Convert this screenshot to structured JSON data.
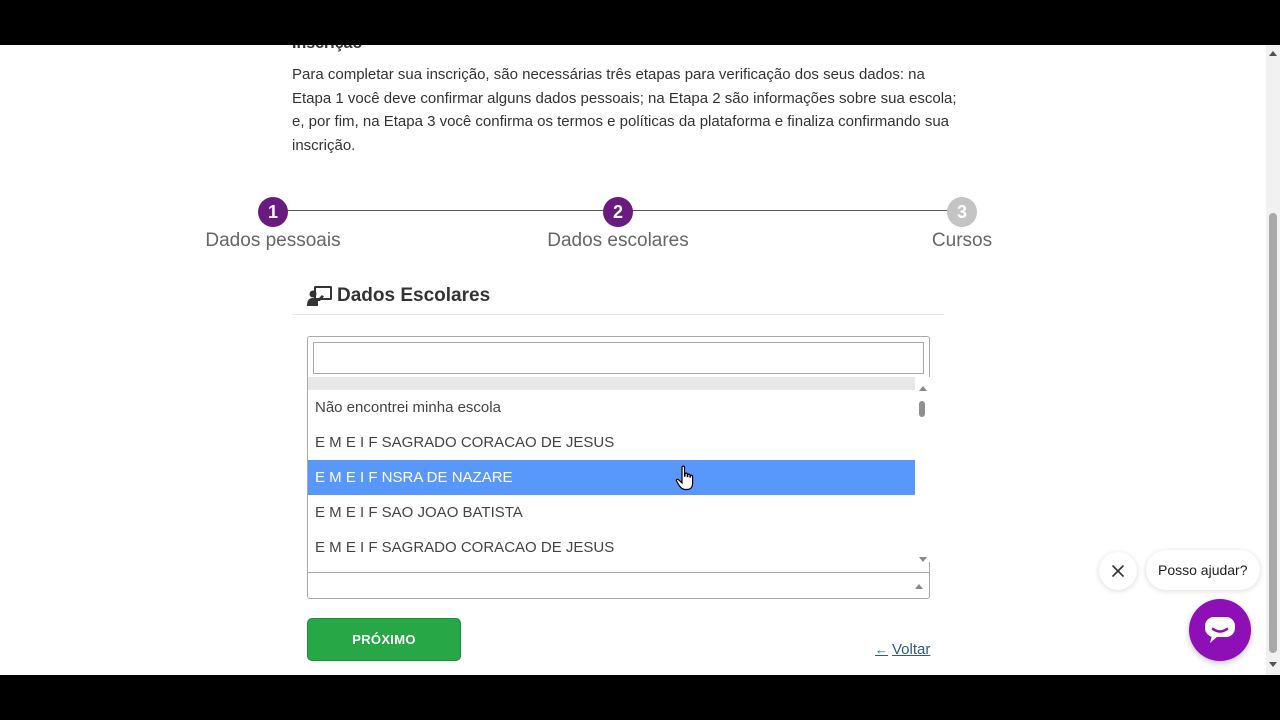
{
  "section": {
    "heading": "Inscrição",
    "intro": "Para completar sua inscrição, são necessárias três etapas para verificação dos seus dados: na Etapa 1 você deve confirmar alguns dados pessoais; na Etapa 2 são informações sobre sua escola; e, por fim, na Etapa 3 você confirma os termos e políticas da plataforma e finaliza confirmando sua inscrição."
  },
  "stepper": {
    "steps": [
      {
        "number": "1",
        "label": "Dados pessoais",
        "state": "active"
      },
      {
        "number": "2",
        "label": "Dados escolares",
        "state": "active"
      },
      {
        "number": "3",
        "label": "Cursos",
        "state": "inactive"
      }
    ],
    "active_color": "#6a1b7f",
    "inactive_color": "#c4c4c4"
  },
  "card": {
    "title": "Dados Escolares",
    "icon": "teacher-board-icon"
  },
  "school_select": {
    "search_value": "",
    "options": [
      "Não encontrei minha escola",
      "E M E I F SAGRADO CORACAO DE JESUS",
      "E M E I F NSRA DE NAZARE",
      "E M E I F SAO JOAO BATISTA",
      "E M E I F SAGRADO CORACAO DE JESUS"
    ],
    "highlighted_index": 2,
    "highlight_color": "#5897fb",
    "selected_value": ""
  },
  "actions": {
    "next_label": "PRÓXIMO",
    "back_label": "Voltar",
    "next_color": "#27a745"
  },
  "chat": {
    "prompt": "Posso ajudar?",
    "launcher_color": "#8e0fb5"
  }
}
